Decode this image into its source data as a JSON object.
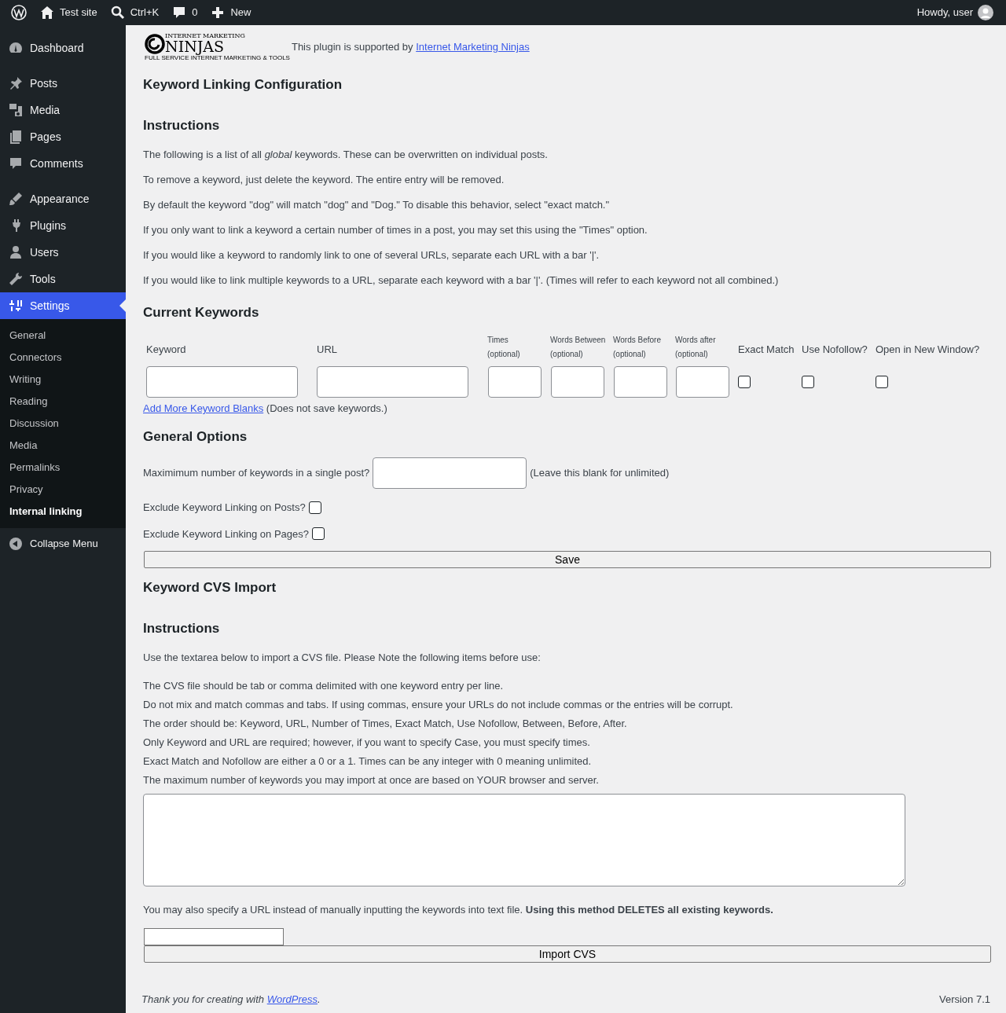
{
  "admin_bar": {
    "items": [
      {
        "kind": "logo"
      },
      {
        "kind": "home",
        "label": "Test site"
      },
      {
        "kind": "search",
        "label": "Ctrl+K"
      },
      {
        "kind": "comments",
        "label": "0"
      },
      {
        "kind": "new",
        "label": "New"
      }
    ],
    "greeting": "Howdy, user"
  },
  "sidebar": {
    "items": [
      {
        "kind": "dashboard",
        "label": "Dashboard",
        "selected": false
      },
      {
        "kind": "posts",
        "label": "Posts",
        "selected": false
      },
      {
        "kind": "media",
        "label": "Media",
        "selected": false
      },
      {
        "kind": "pages",
        "label": "Pages",
        "selected": false
      },
      {
        "kind": "comments",
        "label": "Comments",
        "selected": false
      },
      {
        "kind": "appearance",
        "label": "Appearance",
        "selected": false
      },
      {
        "kind": "plugins",
        "label": "Plugins",
        "selected": false
      },
      {
        "kind": "users",
        "label": "Users",
        "selected": false
      },
      {
        "kind": "tools",
        "label": "Tools",
        "selected": false
      },
      {
        "kind": "settings",
        "label": "Settings",
        "selected": true
      }
    ],
    "submenu": [
      {
        "label": "General",
        "selected": false
      },
      {
        "label": "Connectors",
        "selected": false
      },
      {
        "label": "Writing",
        "selected": false
      },
      {
        "label": "Reading",
        "selected": false
      },
      {
        "label": "Discussion",
        "selected": false
      },
      {
        "label": "Media",
        "selected": false
      },
      {
        "label": "Permalinks",
        "selected": false
      },
      {
        "label": "Privacy",
        "selected": false
      },
      {
        "label": "Internal linking",
        "selected": true
      }
    ],
    "collapse": "Collapse Menu"
  },
  "sponsor": {
    "logo_top": "INTERNET MARKETING",
    "logo_main": "NINJAS",
    "logo_tagline": "FULL SERVICE INTERNET MARKETING & TOOLS",
    "text": "This plugin is supported by ",
    "link": "Internet Marketing Ninjas"
  },
  "page_title": "Keyword Linking Configuration",
  "instructions": {
    "heading": "Instructions",
    "paragraphs": [
      "The following is a list of all *global* keywords. These can be overwritten on individual posts.",
      "To remove a keyword, just delete the keyword. The entire entry will be removed.",
      "By default the keyword \"dog\" will match \"dog\" and \"Dog.\" To disable this behavior, select \"exact match.\"",
      "If you only want to link a keyword a certain number of times in a post, you may set this using the \"Times\" option.",
      "If you would like a keyword to randomly link to one of several URLs, separate each URL with a bar '|'.",
      "If you would like to link multiple keywords to a URL, separate each keyword with a bar '|'. (Times will refer to each keyword not all combined.)"
    ]
  },
  "current_keywords": {
    "heading": "Current Keywords",
    "columns": [
      {
        "kind": "wide",
        "label": "Keyword"
      },
      {
        "kind": "wide",
        "label": "URL"
      },
      {
        "kind": "narrow",
        "label": "Times",
        "note": "(optional)"
      },
      {
        "kind": "narrow",
        "label": "Words Between",
        "note": "(optional)"
      },
      {
        "kind": "narrow",
        "label": "Words Before",
        "note": "(optional)"
      },
      {
        "kind": "narrow",
        "label": "Words after",
        "note": "(optional)"
      },
      {
        "kind": "checkbox",
        "label": "Exact Match",
        "checked": false
      },
      {
        "kind": "checkbox",
        "label": "Use Nofollow?",
        "checked": false
      },
      {
        "kind": "checkbox",
        "label": "Open in New Window?",
        "checked": false
      }
    ],
    "add_link": "Add More Keyword Blanks",
    "add_note": "(Does not save keywords.)"
  },
  "general_options": {
    "heading": "General Options",
    "max_label": "Maximimum number of keywords in a single post?",
    "max_note": "(Leave this blank for unlimited)",
    "excludes": [
      {
        "label": "Exclude Keyword Linking on Posts?",
        "checked": false
      },
      {
        "label": "Exclude Keyword Linking on Pages?",
        "checked": false
      }
    ],
    "save": "Save"
  },
  "import": {
    "heading": "Keyword CVS Import",
    "instructions_heading": "Instructions",
    "intro": "Use the textarea below to import a CVS file. Please Note the following items before use:",
    "items": [
      "The CVS file should be tab or comma delimited with one keyword entry per line.",
      "Do not mix and match commas and tabs. If using commas, ensure your URLs do not include commas or the entries will be corrupt.",
      "The order should be: Keyword, URL, Number of Times, Exact Match, Use Nofollow, Between, Before, After.",
      "Only Keyword and URL are required; however, if you want to specify Case, you must specify times.",
      "Exact Match and Nofollow are either a 0 or a 1. Times can be any integer with 0 meaning unlimited.",
      "The maximum number of keywords you may import at once are based on YOUR browser and server."
    ],
    "url_note": "You may also specify a URL instead of manually inputting the keywords into text file. **Using this method DELETES all existing keywords.**",
    "button": "Import CVS"
  },
  "footer": {
    "text": "Thank you for creating with ",
    "link": "WordPress",
    "after": ".",
    "version": "Version 7.1"
  }
}
